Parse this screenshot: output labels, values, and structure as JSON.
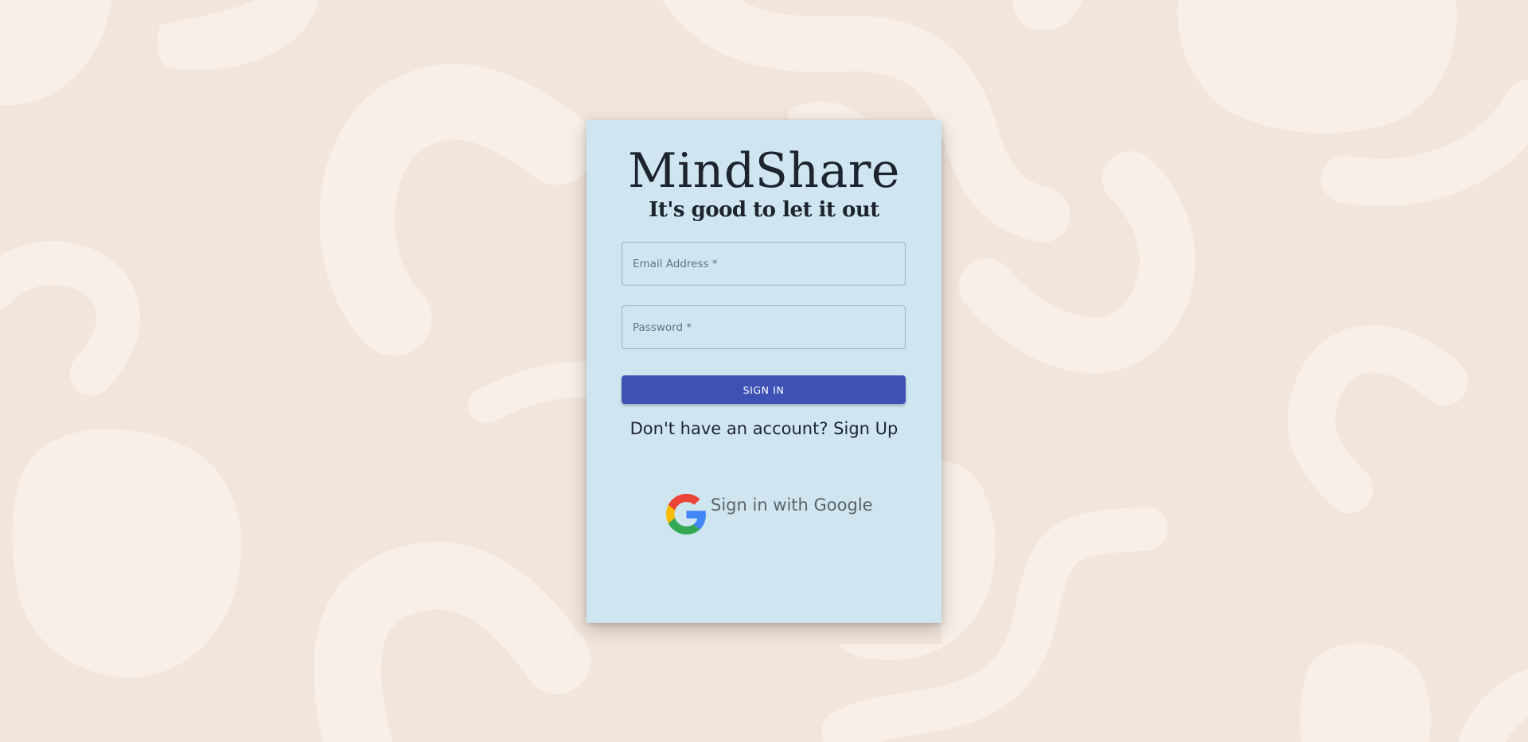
{
  "app": {
    "title": "MindShare",
    "tagline": "It's good to let it out"
  },
  "form": {
    "email_placeholder": "Email Address *",
    "email_value": "",
    "password_placeholder": "Password *",
    "password_value": "",
    "signin_label": "SIGN IN",
    "signup_text": "Don't have an account? Sign Up"
  },
  "google": {
    "label": "Sign in with Google",
    "icon": "google-logo"
  },
  "colors": {
    "background": "#f1e5dc",
    "background_shapes": "#f7efe8",
    "card": "#cfe6f0",
    "primary_button": "#3f51b5",
    "text": "#1d2430"
  }
}
